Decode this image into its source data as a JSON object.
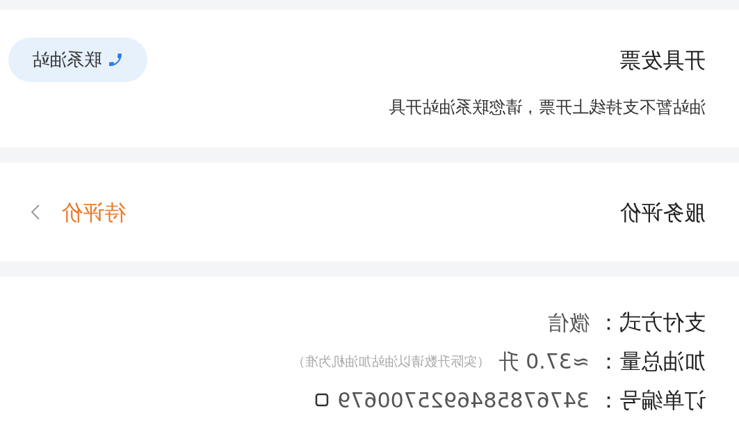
{
  "invoice": {
    "title": "开具发票",
    "contact_button": "联系油站",
    "note": "油站暂不支持线上开票，请您联系油站开具"
  },
  "review": {
    "title": "服务评价",
    "status": "待评价"
  },
  "details": [
    {
      "label": "支付方式：",
      "value": "微信"
    },
    {
      "label": "加油总量：",
      "value": "≈37.0 升",
      "hint": "（实际升数请以油站加油机为准）"
    },
    {
      "label": "订单编号：",
      "value": "3476785846925700679",
      "copyable": true
    }
  ]
}
